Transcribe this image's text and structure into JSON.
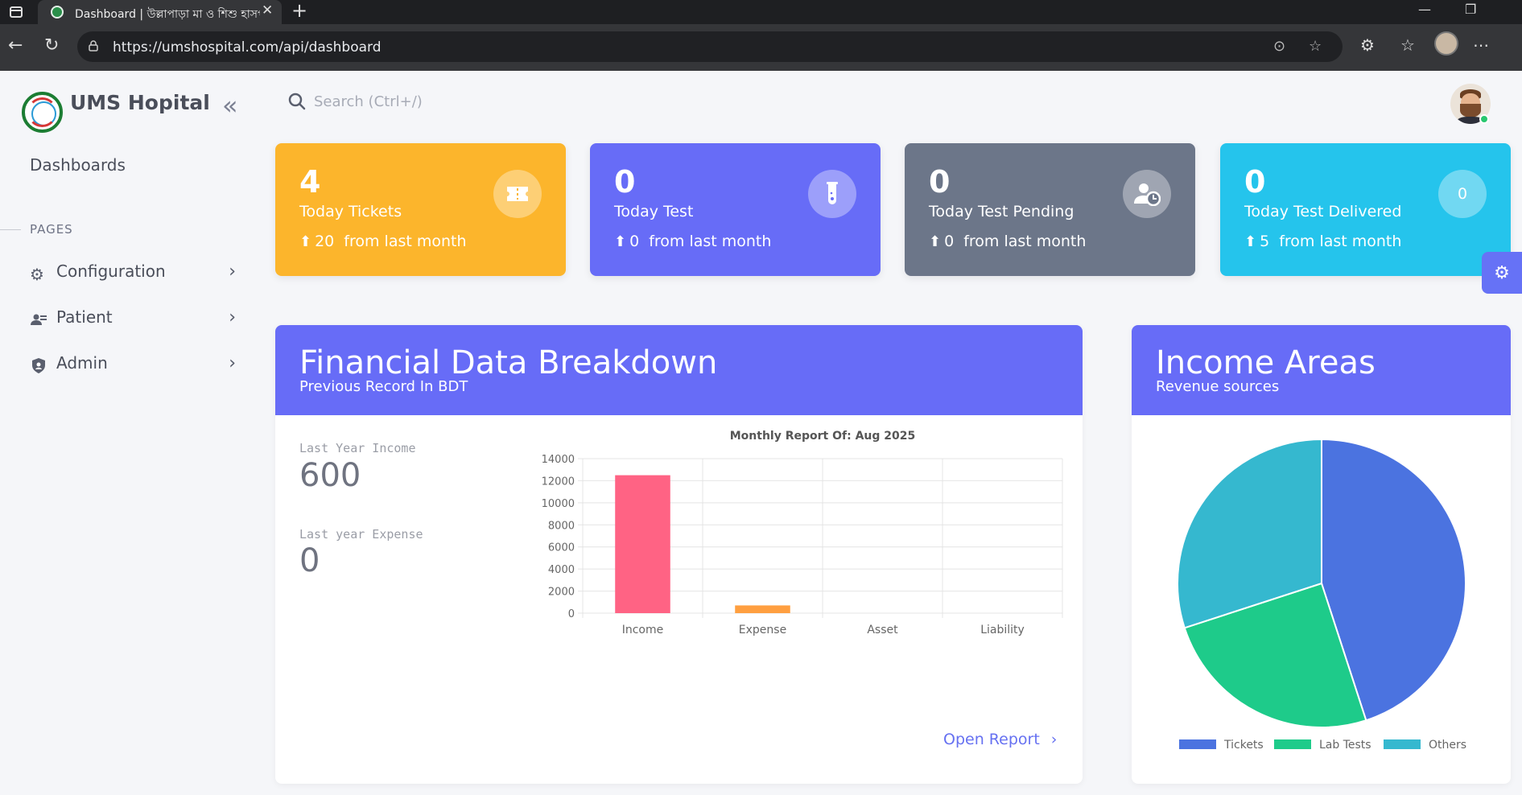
{
  "browser": {
    "tab_title": "Dashboard | উল্লাপাড়া মা ও শিশু হাসপাতাল",
    "url": "https://umshospital.com/api/dashboard"
  },
  "sidebar": {
    "brand": "UMS Hopital",
    "dashboards_label": "Dashboards",
    "section_label": "PAGES",
    "items": [
      {
        "label": "Configuration",
        "icon": "gear-icon"
      },
      {
        "label": "Patient",
        "icon": "users-icon"
      },
      {
        "label": "Admin",
        "icon": "shield-icon"
      }
    ]
  },
  "header": {
    "search_placeholder": "Search (Ctrl+/)"
  },
  "stats": [
    {
      "value": "4",
      "label": "Today Tickets",
      "trend": "20",
      "trend_text": "from last month",
      "color": "#fcb52c",
      "icon": "ticket-icon"
    },
    {
      "value": "0",
      "label": "Today Test",
      "trend": "0",
      "trend_text": "from last month",
      "color": "#676cf7",
      "icon": "test-tube-icon"
    },
    {
      "value": "0",
      "label": "Today Test Pending",
      "trend": "0",
      "trend_text": "from last month",
      "color": "#6c7689",
      "icon": "user-clock-icon"
    },
    {
      "value": "0",
      "label": "Today Test Delivered",
      "trend": "5",
      "trend_text": "from last month",
      "color": "#25c4ec",
      "icon": "badge-icon",
      "icon_text": "0"
    }
  ],
  "financial": {
    "title": "Financial Data Breakdown",
    "subtitle": "Previous Record In BDT",
    "last_year_income_label": "Last Year Income",
    "last_year_income": "600",
    "last_year_expense_label": "Last year Expense",
    "last_year_expense": "0",
    "open_report": "Open Report"
  },
  "income_areas": {
    "title": "Income Areas",
    "subtitle": "Revenue sources"
  },
  "chart_data": [
    {
      "type": "bar",
      "title": "Monthly Report Of: Aug 2025",
      "categories": [
        "Income",
        "Expense",
        "Asset",
        "Liability"
      ],
      "values": [
        12500,
        700,
        0,
        0
      ],
      "colors": [
        "#ff6384",
        "#ff9f40",
        "#ffcd56",
        "#4bc0c0"
      ],
      "ylim": [
        0,
        14000
      ],
      "yticks": [
        0,
        2000,
        4000,
        6000,
        8000,
        10000,
        12000,
        14000
      ],
      "grid": true
    },
    {
      "type": "pie",
      "categories": [
        "Tickets",
        "Lab Tests",
        "Others"
      ],
      "values": [
        45,
        25,
        30
      ],
      "colors": [
        "#4b73e0",
        "#1ecb8a",
        "#35b8cf"
      ],
      "legend": "bottom"
    }
  ]
}
